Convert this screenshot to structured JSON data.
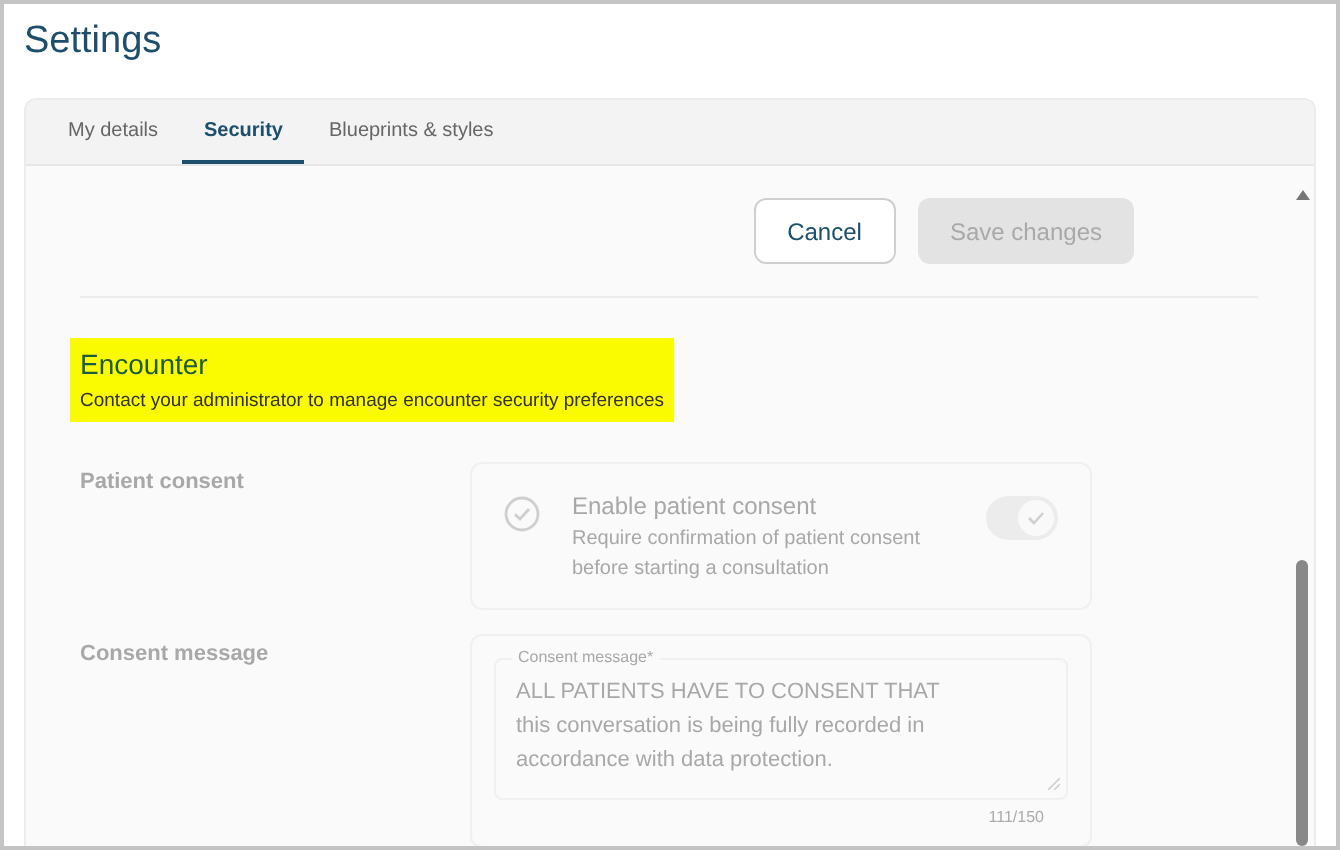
{
  "page": {
    "title": "Settings"
  },
  "tabs": [
    {
      "label": "My details",
      "selected": false
    },
    {
      "label": "Security",
      "selected": true
    },
    {
      "label": "Blueprints & styles",
      "selected": false
    }
  ],
  "actions": {
    "cancel": {
      "label": "Cancel",
      "disabled": false
    },
    "save": {
      "label": "Save changes",
      "disabled": true
    }
  },
  "section": {
    "title": "Encounter",
    "notice": "Contact your administrator to manage encounter security preferences",
    "highlighted": true
  },
  "settings": [
    {
      "kind": "toggle",
      "label": "Patient consent",
      "disabled": true,
      "title": "Enable patient consent",
      "description": "Require confirmation of patient consent before starting a consultation",
      "on": true
    },
    {
      "kind": "textarea",
      "label": "Consent message",
      "disabled": true,
      "field_label": "Consent message*",
      "value": "ALL PATIENTS HAVE TO CONSENT THAT this conversation is being fully recorded in accordance with data protection.",
      "counter": "111/150"
    }
  ]
}
